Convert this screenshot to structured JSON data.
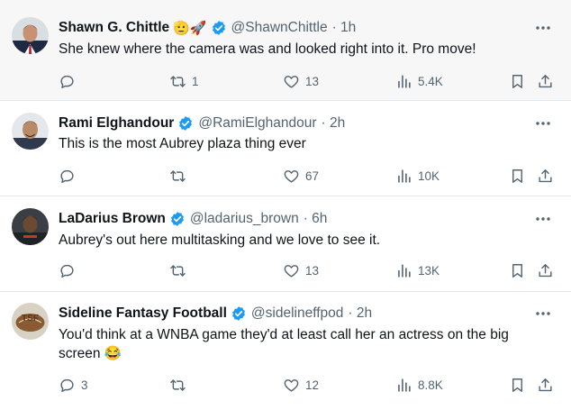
{
  "colors": {
    "accent": "#1d9bf0",
    "muted": "#536471",
    "text": "#0f1419",
    "divider": "#e1e8ed",
    "highlight_bg": "#f7f7f7"
  },
  "tweets": [
    {
      "name": "Shawn G. Chittle",
      "emojis": "🫡🚀",
      "handle": "@ShawnChittle",
      "time": "· 1h",
      "text": "She knew where the camera was and looked right into it. Pro move!",
      "replies": "",
      "retweets": "1",
      "likes": "13",
      "views": "5.4K",
      "avatar_icon": "person-avatar"
    },
    {
      "name": "Rami Elghandour",
      "emojis": "",
      "handle": "@RamiElghandour",
      "time": "· 2h",
      "text": "This is the most Aubrey plaza thing ever",
      "replies": "",
      "retweets": "",
      "likes": "67",
      "views": "10K",
      "avatar_icon": "person-avatar"
    },
    {
      "name": "LaDarius Brown",
      "emojis": "",
      "handle": "@ladarius_brown",
      "time": "· 6h",
      "text": "Aubrey's out here multitasking and we love to see it.",
      "replies": "",
      "retweets": "",
      "likes": "13",
      "views": "13K",
      "avatar_icon": "person-avatar"
    },
    {
      "name": "Sideline Fantasy Football",
      "emojis": "",
      "handle": "@sidelineffpod",
      "time": "· 2h",
      "text": "You'd think at a WNBA game they'd at least call her an actress on the big screen 😂",
      "replies": "3",
      "retweets": "",
      "likes": "12",
      "views": "8.8K",
      "avatar_icon": "tsf-logo-avatar",
      "avatar_logo_text": "TSF"
    }
  ]
}
